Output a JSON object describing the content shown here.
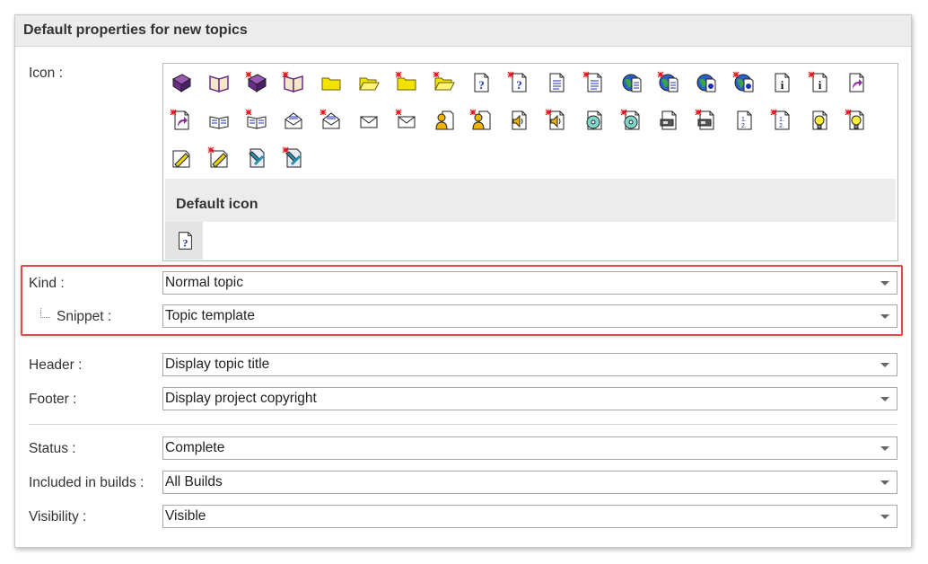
{
  "panel": {
    "title": "Default properties for new topics"
  },
  "icon_field": {
    "label": "Icon :",
    "icons": [
      "book-closed-icon",
      "book-open-icon",
      "book-closed-new-icon",
      "book-open-new-icon",
      "folder-closed-icon",
      "folder-open-icon",
      "folder-closed-new-icon",
      "folder-open-new-icon",
      "help-page-icon",
      "help-page-new-icon",
      "text-page-icon",
      "text-page-new-icon",
      "web-page-icon",
      "web-page-new-icon",
      "globe-page-icon",
      "globe-page-new-icon",
      "info-page-icon",
      "info-page-new-icon",
      "shortcut-page-icon",
      "shortcut-page-new-icon",
      "book-open-small-icon",
      "book-open-small-new-icon",
      "mail-open-icon",
      "mail-open-new-icon",
      "mail-closed-icon",
      "mail-closed-new-icon",
      "user-page-icon",
      "user-page-new-icon",
      "sound-page-icon",
      "sound-page-new-icon",
      "cd-page-icon",
      "cd-page-new-icon",
      "video-page-icon",
      "video-page-new-icon",
      "numbered-page-icon",
      "numbered-page-new-icon",
      "idea-page-icon",
      "idea-page-new-icon",
      "edit-page-icon",
      "edit-page-new-icon",
      "tools-page-icon",
      "tools-page-new-icon"
    ],
    "default_title": "Default icon",
    "default_icon": "help-page-icon"
  },
  "kind": {
    "label": "Kind :",
    "value": "Normal topic"
  },
  "snippet": {
    "label": "Snippet :",
    "value": "Topic template"
  },
  "header": {
    "label": "Header :",
    "value": "Display topic title"
  },
  "footer": {
    "label": "Footer :",
    "value": "Display project copyright"
  },
  "status": {
    "label": "Status :",
    "value": "Complete"
  },
  "included_in_builds": {
    "label": "Included in builds :",
    "value": "All Builds"
  },
  "visibility": {
    "label": "Visibility :",
    "value": "Visible"
  },
  "colors": {
    "highlight": "#e04a4a",
    "header_bg": "#ececec",
    "border": "#c9c9c9"
  }
}
